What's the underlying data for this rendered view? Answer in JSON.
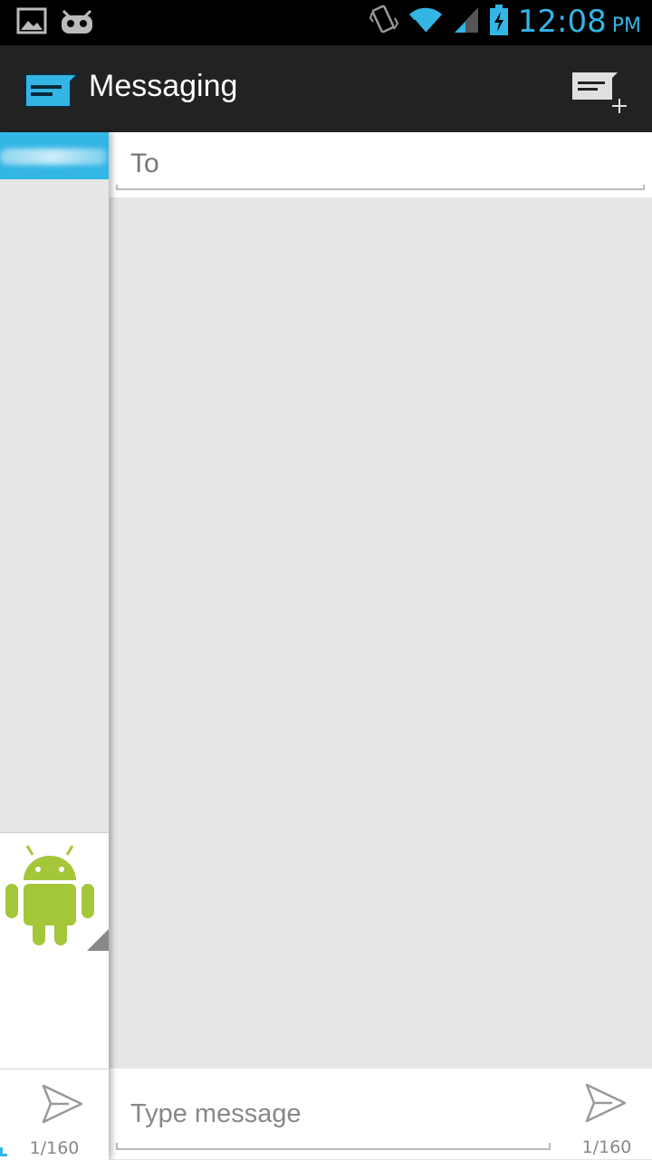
{
  "status_bar": {
    "clock_time": "12:08",
    "clock_ampm": "PM",
    "icons": [
      "image-notification-icon",
      "cyanogen-mascot-icon",
      "vibrate-icon",
      "wifi-icon",
      "signal-icon",
      "battery-charging-icon"
    ],
    "accent_color": "#33b5e5"
  },
  "action_bar": {
    "title": "Messaging",
    "app_icon": "messaging-app-icon",
    "compose_icon": "new-message-icon"
  },
  "recipients": {
    "placeholder": "To"
  },
  "compose": {
    "placeholder": "Type message",
    "counter": "1/160",
    "send_icon": "send-icon"
  },
  "left_panel": {
    "counter": "1/160",
    "avatar_icon": "android-robot-icon"
  },
  "colors": {
    "accent": "#33b5e5",
    "action_bar_bg": "#222222",
    "background": "#e6e6e6",
    "android_green": "#a4c639"
  }
}
